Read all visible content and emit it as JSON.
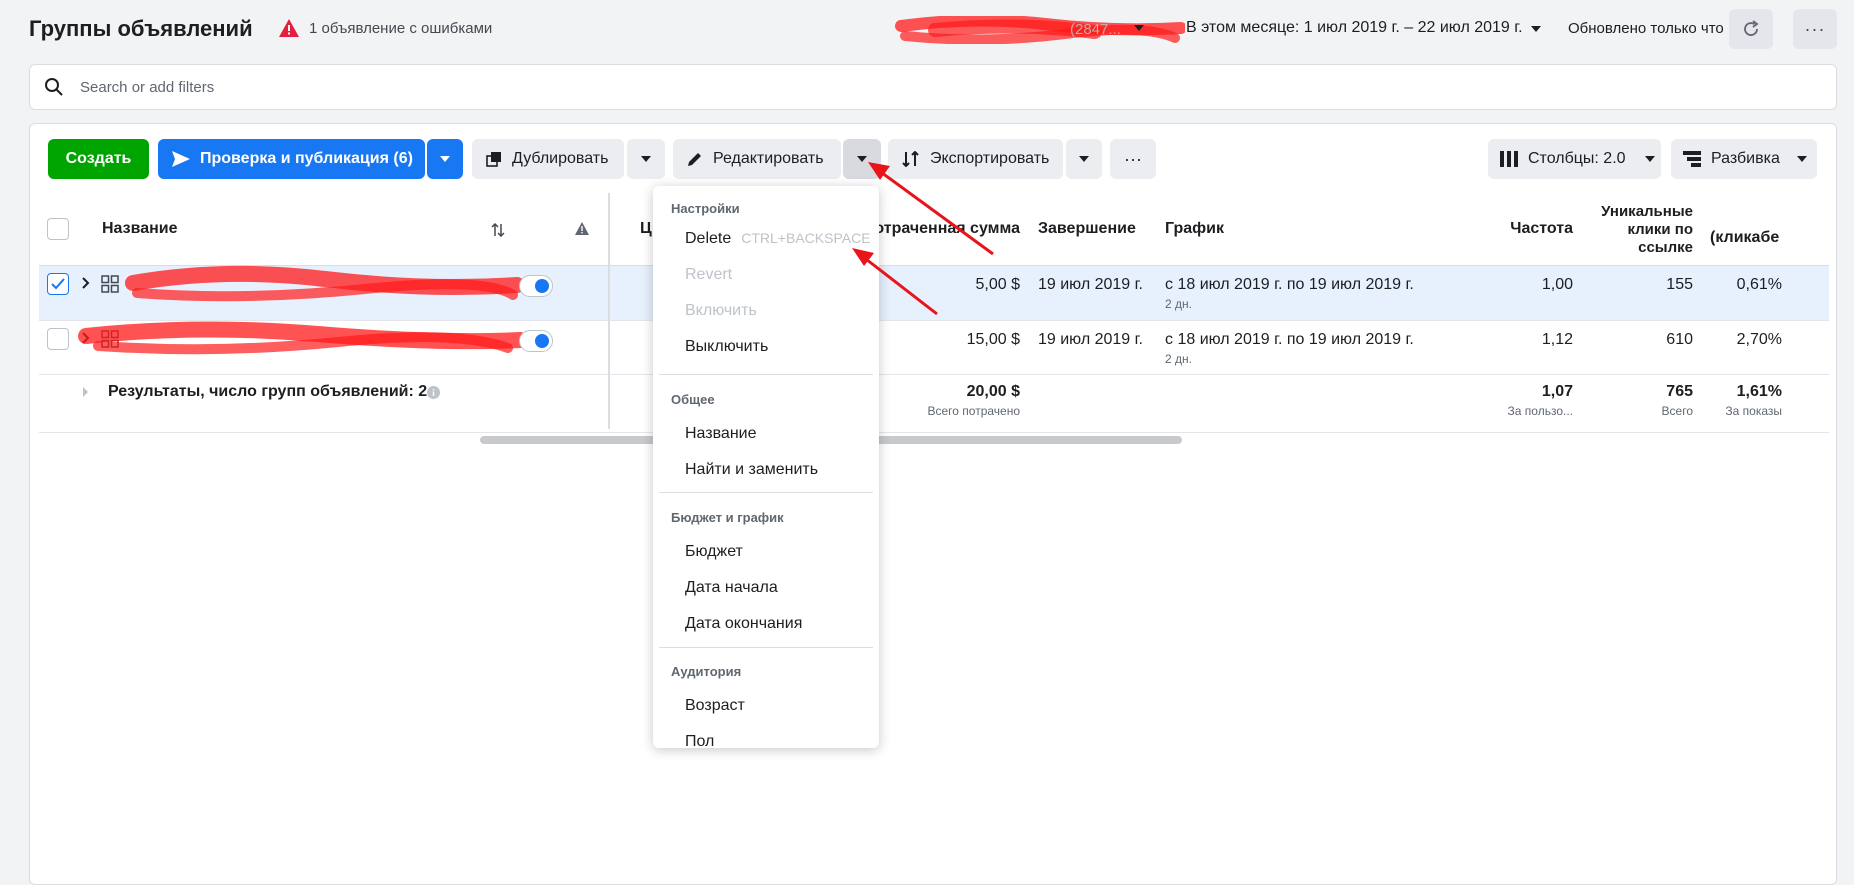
{
  "header": {
    "title": "Группы объявлений",
    "error_text": "1 объявление с ошибками",
    "account_suffix": "(2847...",
    "date_range": "В этом месяце: 1 июл 2019 г. – 22 июл 2019 г.",
    "updated": "Обновлено только что"
  },
  "search": {
    "placeholder": "Search or add filters"
  },
  "toolbar": {
    "create": "Создать",
    "review_publish": "Проверка и публикация (6)",
    "duplicate": "Дублировать",
    "edit": "Редактировать",
    "export": "Экспортировать",
    "columns": "Столбцы: 2.0",
    "breakdown": "Разбивка"
  },
  "table": {
    "headers": {
      "name": "Название",
      "col2_partial": "Ц",
      "spent": "Потраченная сумма",
      "end": "Завершение",
      "schedule": "График",
      "frequency": "Частота",
      "unique_clicks": [
        "Уникальные",
        "клики по",
        "ссылке"
      ],
      "ctr": "(кликабе"
    },
    "rows": [
      {
        "spent": "5,00 $",
        "end": "19 июл 2019 г.",
        "schedule": "с 18 июл 2019 г. по 19 июл 2019 г.",
        "schedule_sub": "2 дн.",
        "frequency": "1,00",
        "unique_clicks": "155",
        "ctr": "0,61%"
      },
      {
        "spent": "15,00 $",
        "end": "19 июл 2019 г.",
        "schedule": "с 18 июл 2019 г. по 19 июл 2019 г.",
        "schedule_sub": "2 дн.",
        "frequency": "1,12",
        "unique_clicks": "610",
        "ctr": "2,70%"
      }
    ],
    "summary": {
      "label": "Результаты, число групп объявлений: 2",
      "spent": "20,00 $",
      "spent_sub": "Всего потрачено",
      "frequency": "1,07",
      "frequency_sub": "За пользо...",
      "unique_clicks": "765",
      "unique_clicks_sub": "Всего",
      "ctr": "1,61%",
      "ctr_sub": "За показы"
    }
  },
  "menu": {
    "sec_settings": "Настройки",
    "delete": "Delete",
    "delete_shortcut": "CTRL+BACKSPACE",
    "revert": "Revert",
    "enable": "Включить",
    "disable": "Выключить",
    "sec_general": "Общее",
    "name": "Название",
    "find_replace": "Найти и заменить",
    "sec_budget": "Бюджет и график",
    "budget": "Бюджет",
    "start_date": "Дата начала",
    "end_date": "Дата окончания",
    "sec_audience": "Аудитория",
    "age": "Возраст",
    "gender": "Пол"
  },
  "colors": {
    "green": "#00a400",
    "blue": "#1877f2",
    "annotation_red": "#e8141a",
    "row_selected": "#e7f0fd"
  }
}
